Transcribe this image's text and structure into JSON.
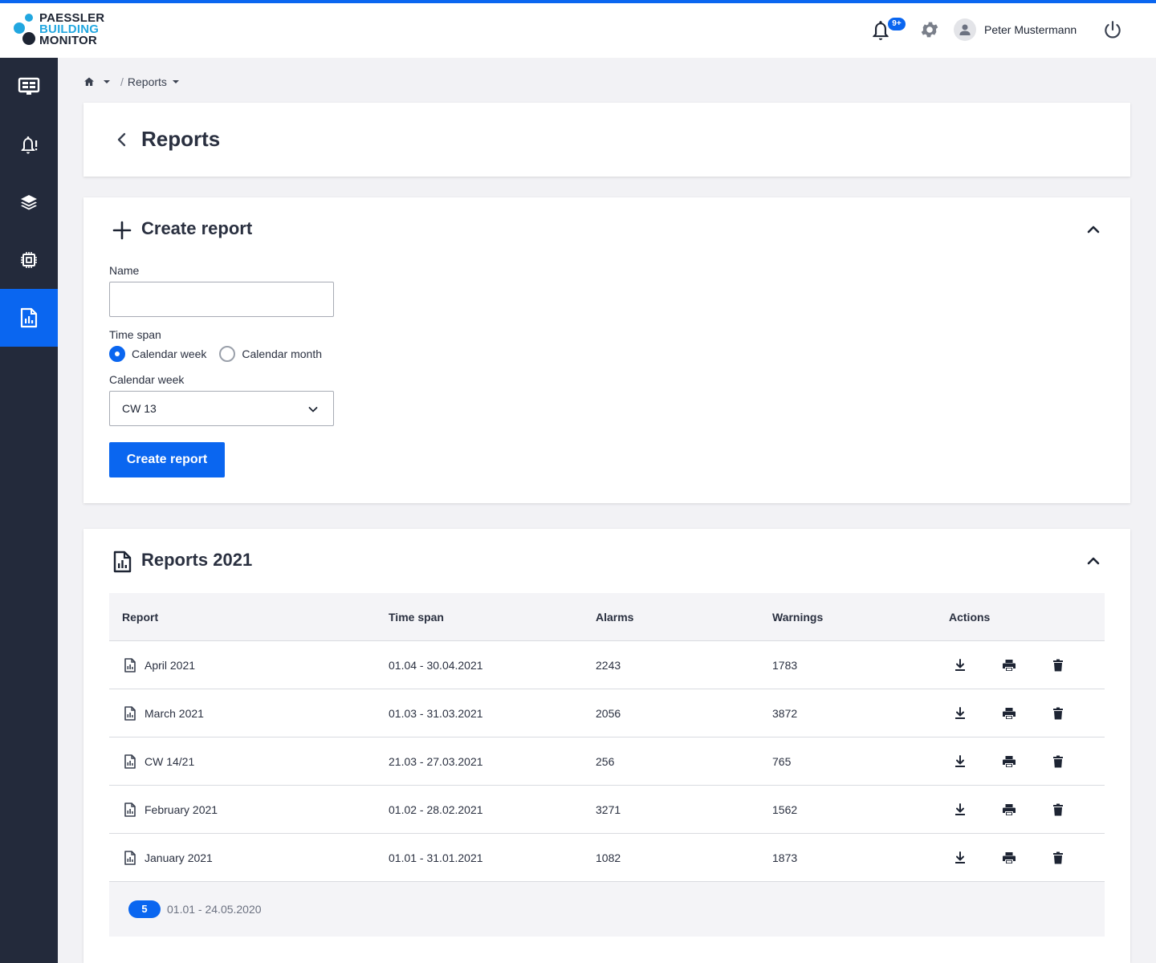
{
  "brand": {
    "line1": "PAESSLER",
    "line2": "BUILDING",
    "line3": "MONITOR"
  },
  "topbar": {
    "notification_badge": "9+",
    "user_name": "Peter Mustermann"
  },
  "sidebar": {
    "items": [
      {
        "icon": "dashboard-icon",
        "active": false
      },
      {
        "icon": "alarm-bell-icon",
        "active": false
      },
      {
        "icon": "layers-icon",
        "active": false
      },
      {
        "icon": "chip-icon",
        "active": false
      },
      {
        "icon": "report-icon",
        "active": true
      }
    ]
  },
  "breadcrumb": {
    "home_icon": "home-icon",
    "current": "Reports"
  },
  "page": {
    "title": "Reports"
  },
  "create_report": {
    "title": "Create report",
    "name_label": "Name",
    "name_value": "",
    "timespan_label": "Time span",
    "options": [
      "Calendar week",
      "Calendar month"
    ],
    "selected_option": "Calendar week",
    "week_label": "Calendar week",
    "week_value": "CW 13",
    "submit_label": "Create report"
  },
  "reports": {
    "title": "Reports 2021",
    "columns": [
      "Report",
      "Time span",
      "Alarms",
      "Warnings",
      "Actions"
    ],
    "rows": [
      {
        "name": "April 2021",
        "time_span": "01.04 - 30.04.2021",
        "alarms": "2243",
        "warnings": "1783"
      },
      {
        "name": "March 2021",
        "time_span": "01.03 - 31.03.2021",
        "alarms": "2056",
        "warnings": "3872"
      },
      {
        "name": "CW 14/21",
        "time_span": "21.03 - 27.03.2021",
        "alarms": "256",
        "warnings": "765"
      },
      {
        "name": "February 2021",
        "time_span": "01.02 - 28.02.2021",
        "alarms": "3271",
        "warnings": "1562"
      },
      {
        "name": "January 2021",
        "time_span": "01.01 - 31.01.2021",
        "alarms": "1082",
        "warnings": "1873"
      }
    ],
    "footer": {
      "count": "5",
      "range": "01.01 - 24.05.2020"
    }
  },
  "colors": {
    "accent": "#0a66f0",
    "sidebar": "#232a3b",
    "logo_blue": "#22a7e0",
    "background": "#f2f2f5"
  }
}
